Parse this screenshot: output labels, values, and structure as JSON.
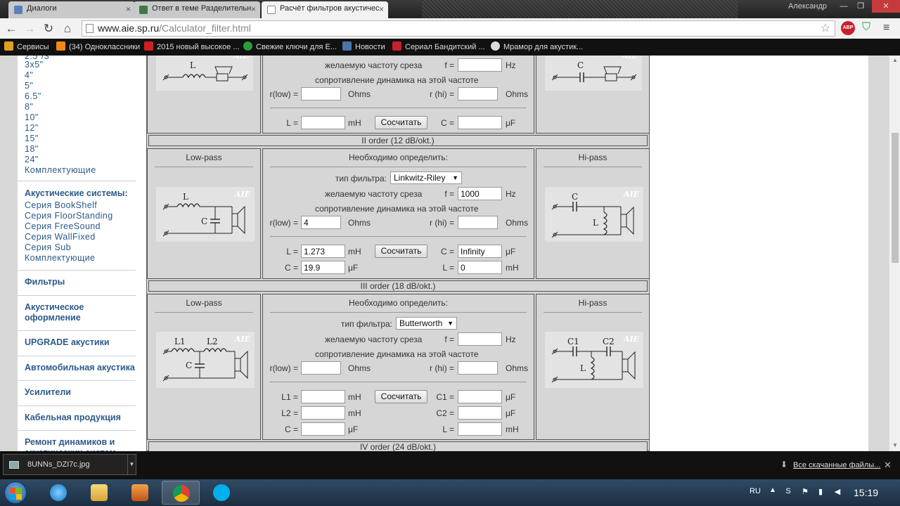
{
  "browser": {
    "tabs": [
      {
        "title": "Диалоги",
        "active": false,
        "icon_color": "#5b7fb8"
      },
      {
        "title": "Ответ в теме Разделительн",
        "active": false,
        "icon_color": "#3a7a4a"
      },
      {
        "title": "Расчёт фильтров акустичес",
        "active": true,
        "icon_color": "#ffffff"
      }
    ],
    "user": "Александр",
    "url_host": "www.aie.sp.ru",
    "url_path": "/Calculator_filter.html",
    "adblock_label": "ABP",
    "bookmarks": [
      {
        "label": "Сервисы",
        "icon_color": "#e0a020"
      },
      {
        "label": "(34) Одноклассники",
        "icon_color": "#f08a10"
      },
      {
        "label": "2015 новый высокое ...",
        "icon_color": "#d02020"
      },
      {
        "label": "Свежие ключи для E...",
        "icon_color": "#2a9d3a"
      },
      {
        "label": "Новости",
        "icon_color": "#4a76a8"
      },
      {
        "label": "Сериал Бандитский ...",
        "icon_color": "#c8202d"
      },
      {
        "label": "Мрамор для акустик...",
        "icon_color": "#dddddd"
      }
    ]
  },
  "sidebar": {
    "sizes": [
      "3x5\"",
      "4\"",
      "5\"",
      "6.5\"",
      "8\"",
      "10\"",
      "12\"",
      "15\"",
      "18\"",
      "24\""
    ],
    "sizes_extra": "Комплектующие",
    "section_title": "Акустические системы:",
    "series": [
      "Серия BookShelf",
      "Серия FloorStanding",
      "Серия FreeSound",
      "Серия WallFixed",
      "Серия Sub",
      "Комплектующие"
    ],
    "menu": [
      "Фильтры",
      "Акустическое оформление",
      "UPGRADE акустики",
      "Автомобильная акустика",
      "Усилители",
      "Кабельная продукция",
      "Ремонт динамиков и акустических систем"
    ]
  },
  "calc": {
    "common": {
      "low_pass": "Low-pass",
      "hi_pass": "Hi-pass",
      "need": "Необходимо определить:",
      "type": "тип фильтра:",
      "freq": "желаемую частоту среза",
      "imp": "сопротивление динамика на этой частоте",
      "f": "f =",
      "hz": "Hz",
      "rlow": "r(low) =",
      "rhi": "r (hi) =",
      "ohms": "Ohms",
      "calc_btn": "Сосчитать",
      "mH": "mH",
      "uF": "μF",
      "aie": "AIE"
    },
    "order1": {
      "f": "",
      "rlow": "",
      "rhi": "",
      "L_label": "L =",
      "L": "",
      "C_label": "C =",
      "C": ""
    },
    "order2": {
      "band": "II order (12 dB/okt.)",
      "type_value": "Linkwitz-Riley",
      "f": "1000",
      "rlow": "4",
      "rhi": "",
      "L_label": "L =",
      "L": "1.273",
      "C_label": "C =",
      "C": "19.9",
      "hC_label": "C =",
      "hC": "Infinity",
      "hL_label": "L =",
      "hL": "0"
    },
    "order3": {
      "band": "III order (18 dB/okt.)",
      "type_value": "Butterworth",
      "f": "",
      "rlow": "",
      "rhi": "",
      "L1_label": "L1 =",
      "L1": "",
      "L2_label": "L2 =",
      "L2": "",
      "C_label": "C =",
      "C": "",
      "C1_label": "C1 =",
      "C1": "",
      "C2_label": "C2 =",
      "C2": "",
      "hL_label": "L =",
      "hL": ""
    },
    "order4": {
      "band": "IV order (24 dB/okt.)"
    }
  },
  "downloads": {
    "file": "8UNNs_DZI7c.jpg",
    "all_link": "Все скачанные файлы..."
  },
  "taskbar": {
    "lang": "RU",
    "time": "15:19"
  }
}
